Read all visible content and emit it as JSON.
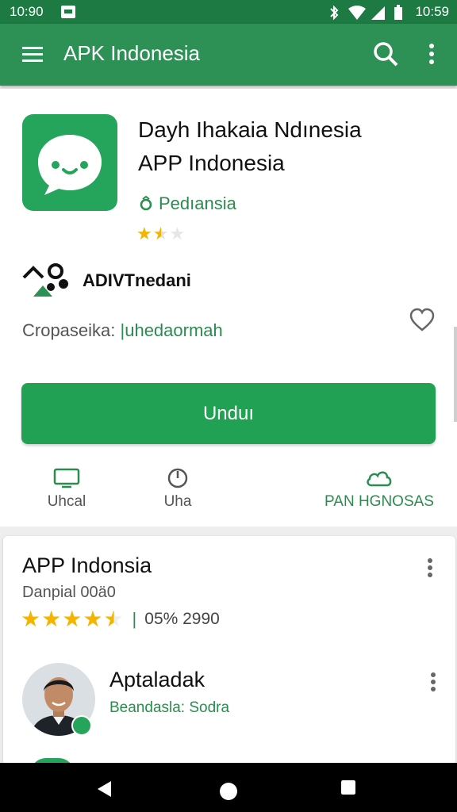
{
  "status_bar": {
    "time_left": "10:90",
    "time_right": "10:59"
  },
  "app_bar": {
    "title": "APK Indonesia",
    "icons": [
      "menu-icon",
      "search-icon",
      "more-vert-icon"
    ]
  },
  "app_header": {
    "title_line1": "Dayh Ihakaia Ndınesia",
    "title_line2": "APP Indonesia",
    "developer": "Pedıansia",
    "rating_stars": 1.5,
    "rating_max": 5
  },
  "publisher": {
    "name": "ADIVTnedani"
  },
  "category": {
    "label": "Cropaseika:",
    "value": "|uhedaormah"
  },
  "install_button": {
    "label": "Unduı"
  },
  "actions": [
    {
      "label": "Uhcal",
      "icon": "screen-icon"
    },
    {
      "label": "Uha",
      "icon": "clock-icon"
    },
    {
      "label": "PAN HGNOSAS",
      "icon": "cloud-icon"
    }
  ],
  "review_card": {
    "title": "APP Indonsia",
    "subtitle": "Danpial 00ä0",
    "rating_stars": 4.5,
    "rating_max": 5,
    "count": "05% 2990",
    "reviewer": {
      "name": "Aptaladak",
      "subtitle": "Beandasla: Sodra"
    }
  },
  "colors": {
    "status_bar": "#1e7a43",
    "app_bar": "#2d9156",
    "accent_green": "#21a153",
    "star_yellow": "#f4b400"
  }
}
